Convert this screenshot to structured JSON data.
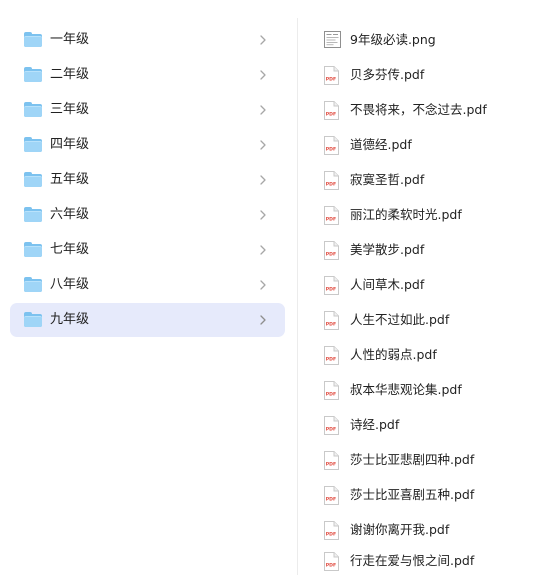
{
  "folders": [
    {
      "label": "一年级"
    },
    {
      "label": "二年级"
    },
    {
      "label": "三年级"
    },
    {
      "label": "四年级"
    },
    {
      "label": "五年级"
    },
    {
      "label": "六年级"
    },
    {
      "label": "七年级"
    },
    {
      "label": "八年级"
    },
    {
      "label": "九年级"
    }
  ],
  "selected_folder": "九年级",
  "files": [
    {
      "name": "9年级必读.png",
      "type": "png"
    },
    {
      "name": "贝多芬传.pdf",
      "type": "pdf"
    },
    {
      "name": "不畏将来，不念过去.pdf",
      "type": "pdf"
    },
    {
      "name": "道德经.pdf",
      "type": "pdf"
    },
    {
      "name": "寂寞圣哲.pdf",
      "type": "pdf"
    },
    {
      "name": "丽江的柔软时光.pdf",
      "type": "pdf"
    },
    {
      "name": "美学散步.pdf",
      "type": "pdf"
    },
    {
      "name": "人间草木.pdf",
      "type": "pdf"
    },
    {
      "name": "人生不过如此.pdf",
      "type": "pdf"
    },
    {
      "name": "人性的弱点.pdf",
      "type": "pdf"
    },
    {
      "name": "叔本华悲观论集.pdf",
      "type": "pdf"
    },
    {
      "name": "诗经.pdf",
      "type": "pdf"
    },
    {
      "name": "莎士比亚悲剧四种.pdf",
      "type": "pdf"
    },
    {
      "name": "莎士比亚喜剧五种.pdf",
      "type": "pdf"
    },
    {
      "name": "谢谢你离开我.pdf",
      "type": "pdf"
    },
    {
      "name": "行走在爱与恨之间.pdf",
      "type": "pdf"
    }
  ],
  "icons": {
    "folder": "folder-icon",
    "chevron": "chevron-right-icon",
    "pdf": "pdf-file-icon",
    "png": "image-file-icon"
  },
  "colors": {
    "selection": "#e6eafb",
    "folder": "#7cc2ef",
    "pdf_accent": "#e0463b"
  }
}
